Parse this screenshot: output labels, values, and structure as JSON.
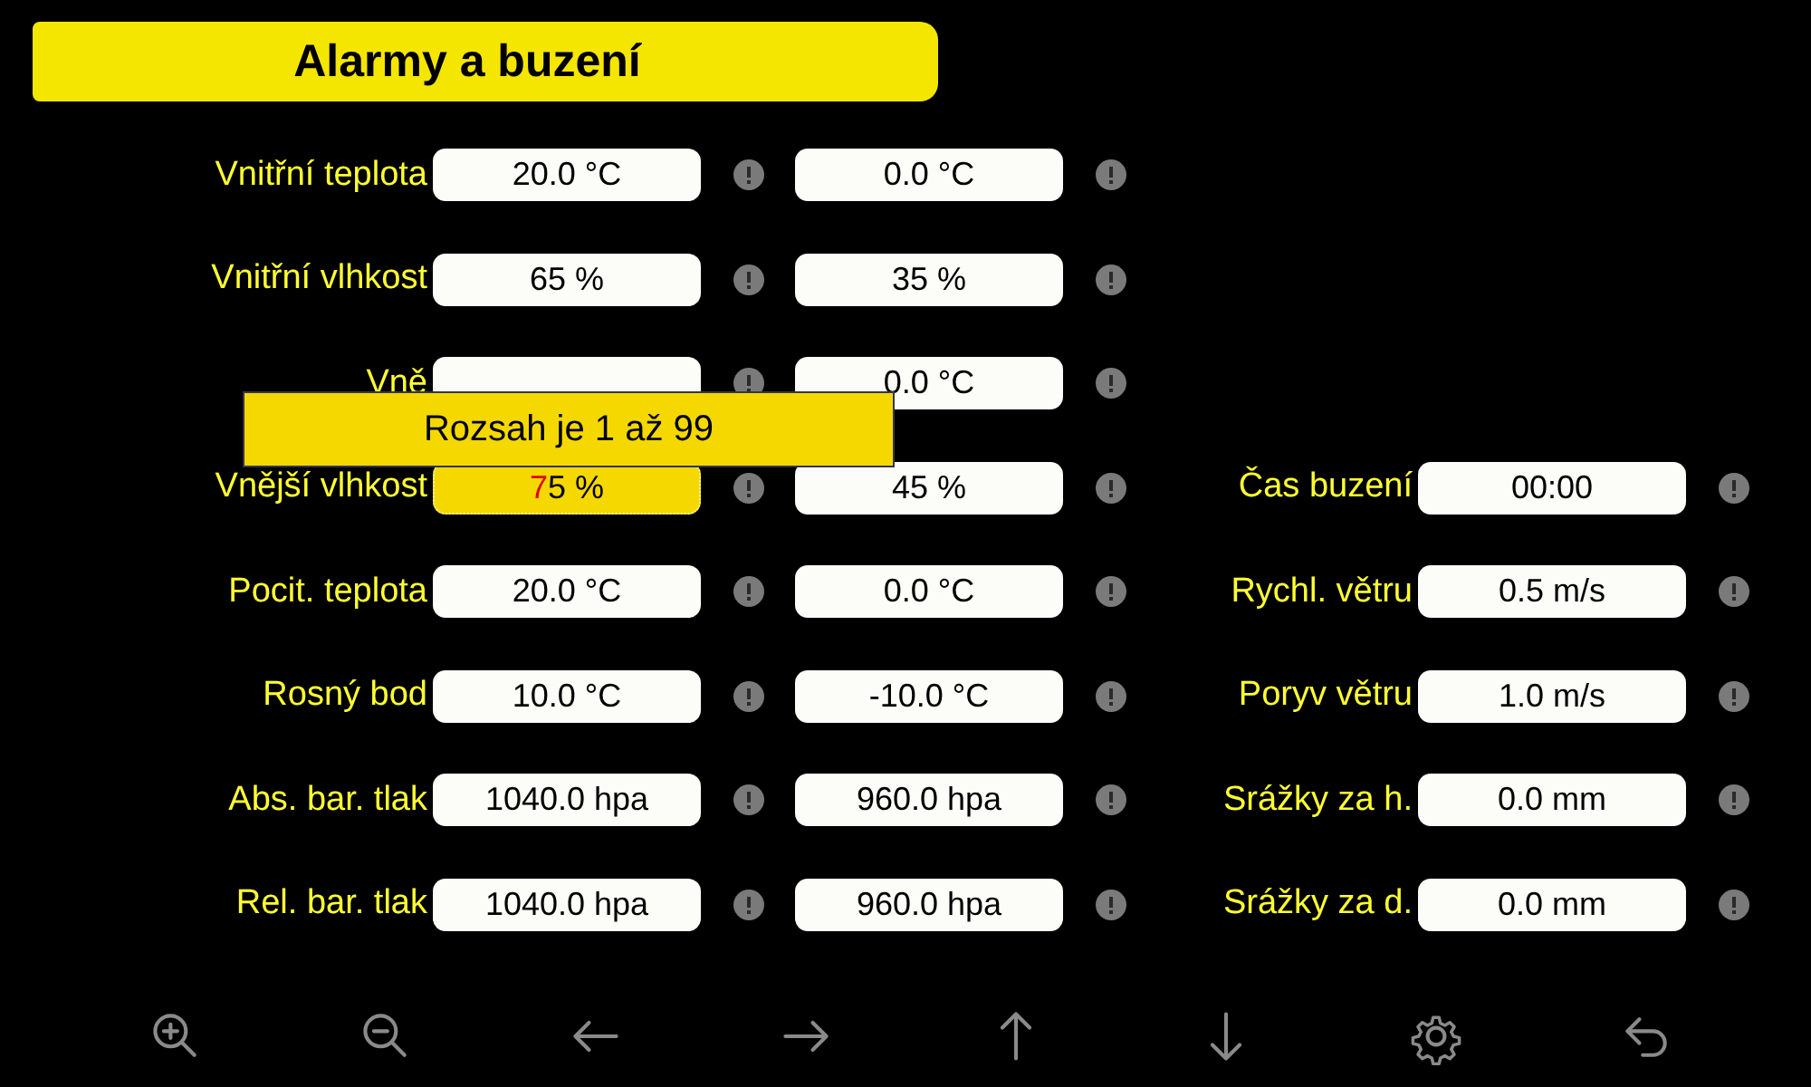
{
  "title": "Alarmy a buzení",
  "rows": [
    {
      "label": "Vnitřní teplota",
      "fields": [
        {
          "value": "20.0 °C",
          "editing": false
        },
        {
          "value": "0.0 °C",
          "editing": false
        }
      ]
    },
    {
      "label": "Vnitřní vlhkost",
      "fields": [
        {
          "value": "65 %",
          "editing": false
        },
        {
          "value": "35 %",
          "editing": false
        }
      ]
    },
    {
      "label": "Vně",
      "fields": [
        {
          "editing": false
        },
        {
          "value": "0.0 °C",
          "editing": false
        }
      ]
    },
    {
      "label": "Vnější vlhkost",
      "fields": [
        {
          "value": "75 %",
          "editing": true
        },
        {
          "value": "45 %",
          "editing": false
        }
      ]
    },
    {
      "label": "Pocit. teplota",
      "fields": [
        {
          "value": "20.0 °C",
          "editing": false
        },
        {
          "value": "0.0 °C",
          "editing": false
        }
      ]
    },
    {
      "label": "Rosný bod",
      "fields": [
        {
          "value": "10.0 °C",
          "editing": false
        },
        {
          "value": "-10.0 °C",
          "editing": false
        }
      ]
    },
    {
      "label": "Abs. bar. tlak",
      "fields": [
        {
          "value": "1040.0 hpa",
          "editing": false
        },
        {
          "value": "960.0 hpa",
          "editing": false
        }
      ]
    },
    {
      "label": "Rel. bar. tlak",
      "fields": [
        {
          "value": "1040.0 hpa",
          "editing": false
        },
        {
          "value": "960.0 hpa",
          "editing": false
        }
      ]
    }
  ],
  "side_rows": [
    {
      "label": "Čas buzení",
      "field": {
        "value": "00:00",
        "editing": false
      }
    },
    {
      "label": "Rychl. větru",
      "field": {
        "value": "0.5 m/s",
        "editing": false
      }
    },
    {
      "label": "Poryv větru",
      "field": {
        "value": "1.0 m/s",
        "editing": false
      }
    },
    {
      "label": "Srážky za h.",
      "field": {
        "value": "0.0 mm",
        "editing": false
      }
    },
    {
      "label": "Srážky za d.",
      "field": {
        "value": "0.0 mm",
        "editing": false
      }
    }
  ],
  "tooltip": {
    "text": "Rozsah je 1 až 99"
  },
  "toolbar": [
    {
      "kind": "zoom-in"
    },
    {
      "kind": "zoom-out"
    },
    {
      "kind": "left"
    },
    {
      "kind": "right"
    },
    {
      "kind": "up"
    },
    {
      "kind": "down"
    },
    {
      "kind": "settings"
    },
    {
      "kind": "back"
    }
  ]
}
